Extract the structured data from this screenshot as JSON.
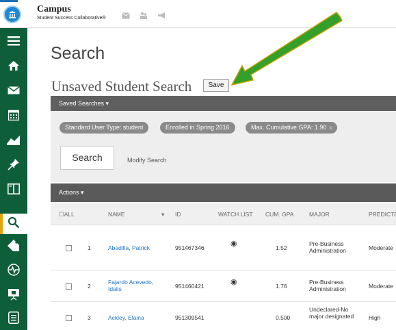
{
  "topbar": {
    "brand_title": "Campus",
    "brand_subtitle": "Student Success Collaborative®",
    "icons": [
      "mail-icon",
      "people-icon",
      "megaphone-icon"
    ]
  },
  "sidebar": {
    "items": [
      {
        "icon": "menu-icon"
      },
      {
        "icon": "home-icon"
      },
      {
        "icon": "mail-icon"
      },
      {
        "icon": "calendar-icon"
      },
      {
        "icon": "analytics-icon"
      },
      {
        "icon": "pin-icon"
      },
      {
        "icon": "book-icon"
      },
      {
        "icon": "search-icon",
        "active": true
      },
      {
        "icon": "tag-icon"
      },
      {
        "icon": "heartbeat-icon"
      },
      {
        "icon": "presentation-icon"
      },
      {
        "icon": "document-icon"
      }
    ]
  },
  "page": {
    "title": "Search",
    "subtitle": "Unsaved Student Search",
    "save_label": "Save"
  },
  "saved_searches": {
    "label": "Saved Searches ▾"
  },
  "filters": {
    "pills": [
      {
        "text": "Standard User Type: student"
      },
      {
        "text": "Enrolled in Spring 2016"
      },
      {
        "text": "Max. Cumulative GPA: 1.90",
        "removable": "x"
      }
    ],
    "search_button": "Search",
    "modify_link": "Modify Search"
  },
  "table": {
    "actions_label": "Actions ▾",
    "headers": {
      "all": "☐ALL",
      "name": "NAME",
      "sort": "▾",
      "id": "ID",
      "watch": "WATCH LIST",
      "gpa": "CUM. GPA",
      "major": "MAJOR",
      "predicted": "PREDICTE"
    },
    "rows": [
      {
        "num": "1",
        "name": "Abadilla, Patrick",
        "id": "951467346",
        "watch": "◉",
        "gpa": "1.52",
        "major": "Pre-Business Administration",
        "predicted": "Moderate"
      },
      {
        "num": "2",
        "name": "Fajardo Acevedo, Idalis",
        "id": "951460421",
        "watch": "◉",
        "gpa": "1.76",
        "major": "Pre-Business Administration",
        "predicted": "Moderate"
      },
      {
        "num": "3",
        "name": "Ackley, Elaina",
        "id": "951309541",
        "watch": "",
        "gpa": "0.500",
        "major": "Undeclared-No major designated",
        "predicted": "High"
      }
    ]
  },
  "colors": {
    "sidebar": "#0f5e3a",
    "accent_active": "#e5a40a",
    "link": "#2275c6",
    "arrow": "#33a02c"
  }
}
